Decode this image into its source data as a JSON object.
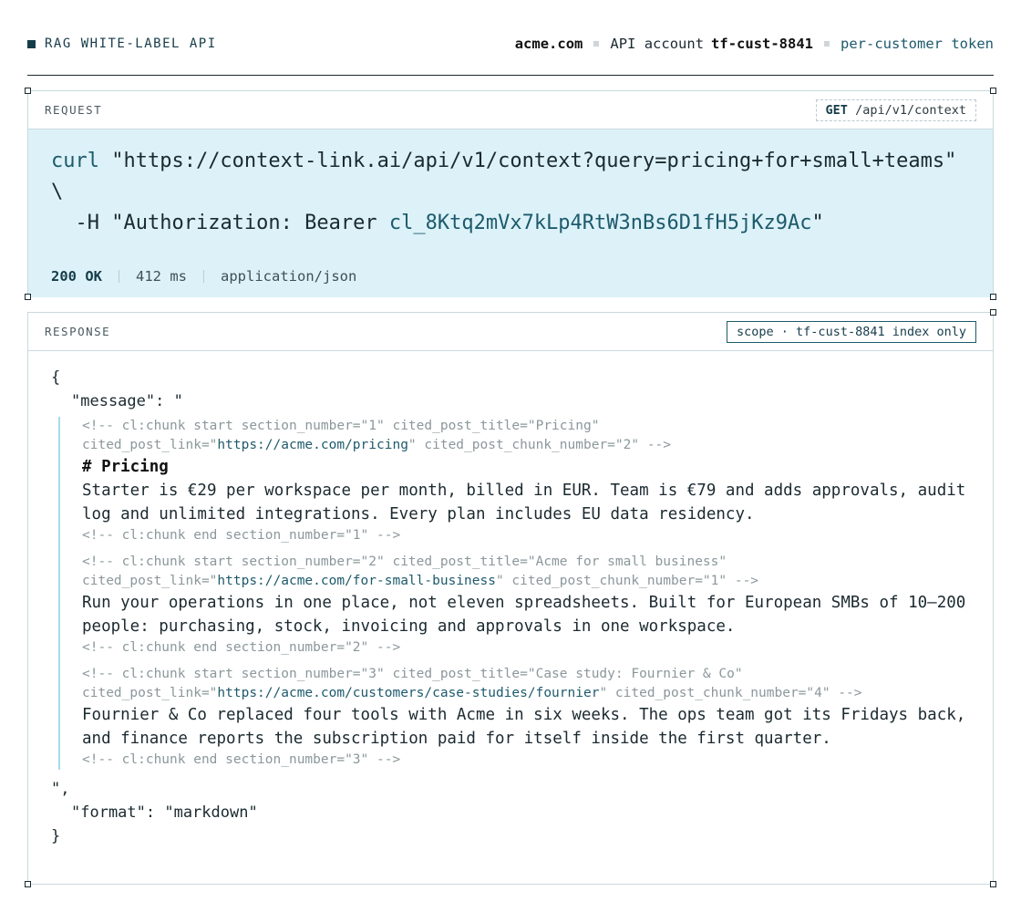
{
  "header": {
    "brand": "RAG WHITE-LABEL API",
    "domain": "acme.com",
    "account_prefix": "API account",
    "account_id": "tf-cust-8841",
    "token_type": "per-customer token"
  },
  "request": {
    "label": "REQUEST",
    "method": "GET",
    "path": "/api/v1/context",
    "curl_cmd": "curl",
    "curl_url": " \"https://context-link.ai/api/v1/context?query=pricing+for+small+teams\" \\",
    "curl_header_prefix": "  -H \"Authorization: Bearer ",
    "curl_token": "cl_8Ktq2mVx7kLp4RtW3nBs6D1fH5jKz9Ac",
    "curl_header_suffix": "\"",
    "status": "200 OK",
    "latency": "412 ms",
    "content_type": "application/json"
  },
  "response": {
    "label": "RESPONSE",
    "scope": "scope · tf-cust-8841 index only",
    "open_brace": "{",
    "message_key": "\"message\": \"",
    "chunks": [
      {
        "start_line1": "<!-- cl:chunk start section_number=\"1\" cited_post_title=\"Pricing\"",
        "link_prefix": "cited_post_link=\"",
        "link": "https://acme.com/pricing",
        "link_suffix": "\" cited_post_chunk_number=\"2\" -->",
        "heading": "# Pricing",
        "body": "Starter is €29 per workspace per month, billed in EUR. Team is €79 and adds approvals, audit log and unlimited integrations. Every plan includes EU data residency.",
        "end": "<!-- cl:chunk end section_number=\"1\" -->"
      },
      {
        "start_line1": "<!-- cl:chunk start section_number=\"2\" cited_post_title=\"Acme for small business\"",
        "link_prefix": "cited_post_link=\"",
        "link": "https://acme.com/for-small-business",
        "link_suffix": "\" cited_post_chunk_number=\"1\" -->",
        "heading": "",
        "body": "Run your operations in one place, not eleven spreadsheets. Built for European SMBs of 10–200 people: purchasing, stock, invoicing and approvals in one workspace.",
        "end": "<!-- cl:chunk end section_number=\"2\" -->"
      },
      {
        "start_line1": "<!-- cl:chunk start section_number=\"3\" cited_post_title=\"Case study: Fournier & Co\"",
        "link_prefix": "cited_post_link=\"",
        "link": "https://acme.com/customers/case-studies/fournier",
        "link_suffix": "\" cited_post_chunk_number=\"4\" -->",
        "heading": "",
        "body": "Fournier & Co replaced four tools with Acme in six weeks. The ops team got its Fridays back, and finance reports the subscription paid for itself inside the first quarter.",
        "end": "<!-- cl:chunk end section_number=\"3\" -->"
      }
    ],
    "message_close": "\",",
    "format_line": "\"format\": \"markdown\"",
    "close_brace": "}"
  }
}
